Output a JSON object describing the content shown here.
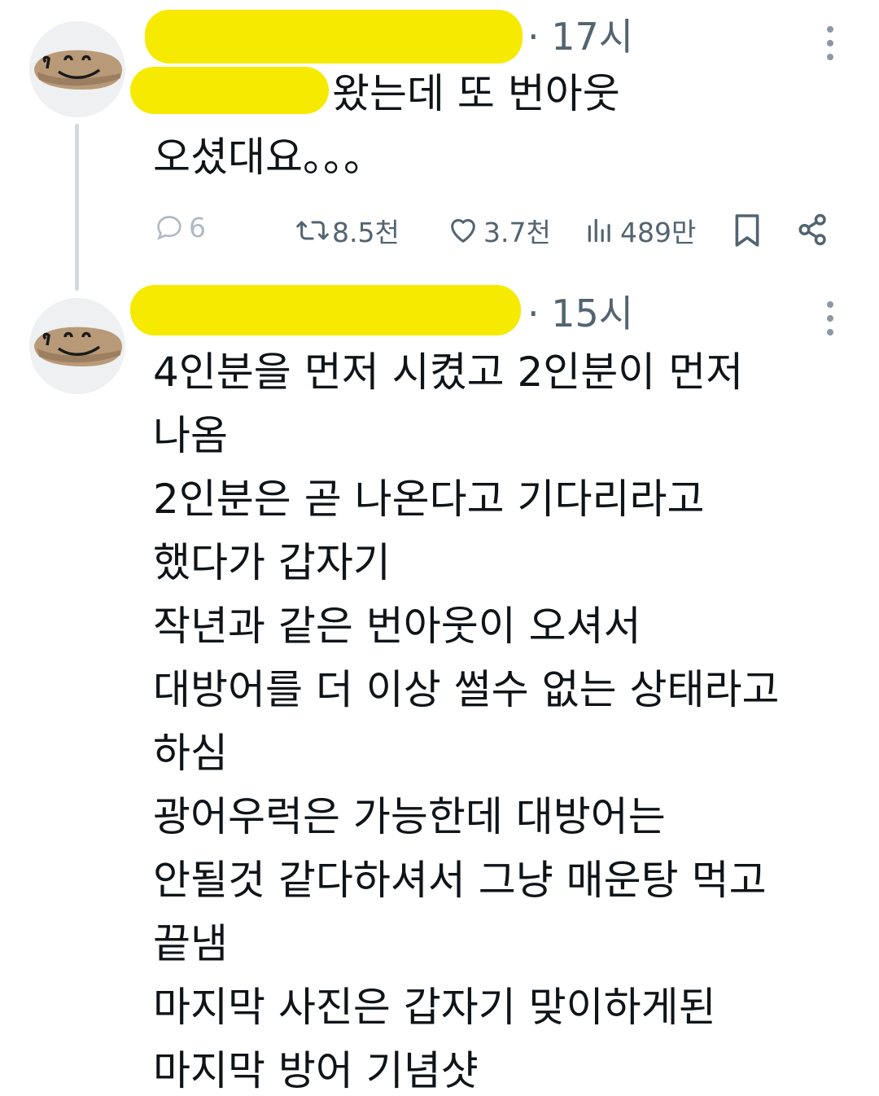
{
  "tweets": [
    {
      "time": "· 17시",
      "text_lines": [
        "왔는데 또 번아웃",
        "오셨대요。。。"
      ],
      "actions": {
        "replies": "6",
        "retweets": "8.5천",
        "likes": "3.7천",
        "views": "489만"
      }
    },
    {
      "time": "· 15시",
      "text_lines": [
        "4인분을 먼저 시켰고 2인분이 먼저",
        "나옴",
        "2인분은 곧 나온다고 기다리라고",
        "했다가 갑자기",
        "작년과 같은 번아웃이 오셔서",
        "대방어를 더 이상 썰수 없는 상태라고",
        "하심",
        "광어우럭은 가능한데 대방어는",
        "안될것 같다하셔서 그냥 매운탕 먹고",
        "끝냄",
        "마지막 사진은 갑자기 맞이하게된",
        "마지막 방어 기념샷"
      ]
    }
  ],
  "colors": {
    "redaction": "#f6ea00",
    "meta_gray": "#536471",
    "thread_line": "#cfd9de"
  }
}
